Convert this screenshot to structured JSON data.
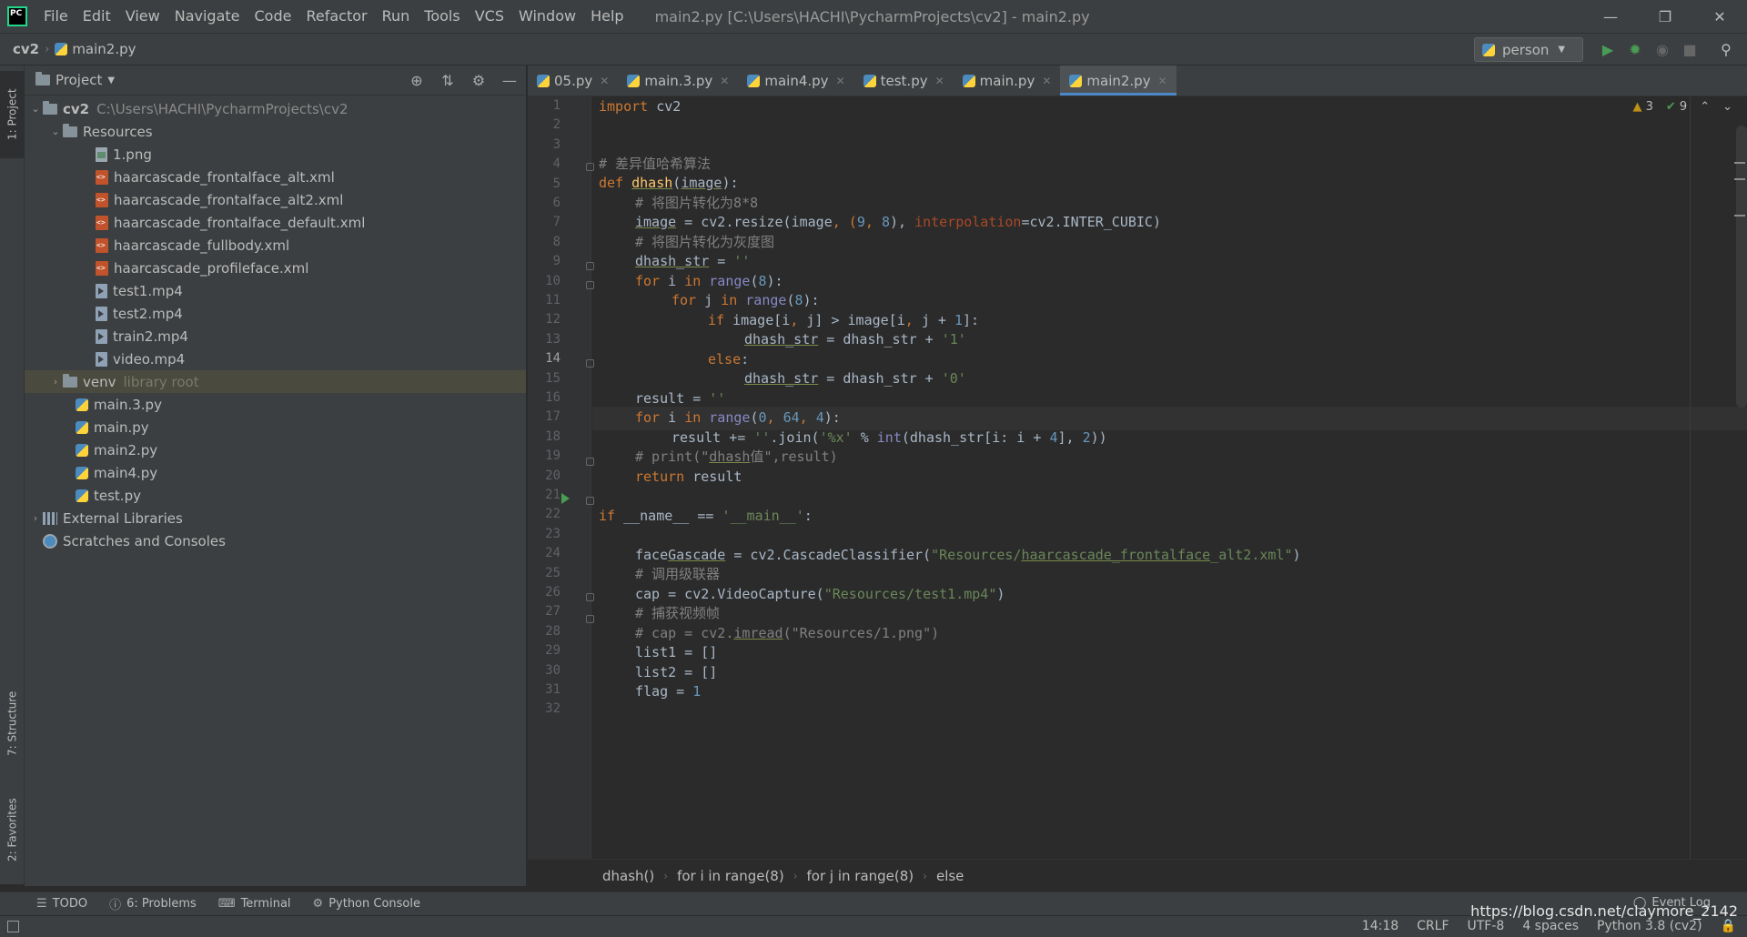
{
  "menu": [
    "File",
    "Edit",
    "View",
    "Navigate",
    "Code",
    "Refactor",
    "Run",
    "Tools",
    "VCS",
    "Window",
    "Help"
  ],
  "window_title": "main2.py [C:\\Users\\HACHI\\PycharmProjects\\cv2] - main2.py",
  "nav": {
    "project": "cv2",
    "file": "main2.py",
    "run_config": "person"
  },
  "left_strip": {
    "project_tab": "1: Project",
    "structure_tab": "7: Structure",
    "favorites_tab": "2: Favorites"
  },
  "project_panel": {
    "title": "Project",
    "root": {
      "name": "cv2",
      "path": "C:\\Users\\HACHI\\PycharmProjects\\cv2"
    },
    "resources_folder": "Resources",
    "resource_files": [
      "1.png",
      "haarcascade_frontalface_alt.xml",
      "haarcascade_frontalface_alt2.xml",
      "haarcascade_frontalface_default.xml",
      "haarcascade_fullbody.xml",
      "haarcascade_profileface.xml",
      "test1.mp4",
      "test2.mp4",
      "train2.mp4",
      "video.mp4"
    ],
    "venv": {
      "name": "venv",
      "hint": "library root"
    },
    "py_files": [
      "main.3.py",
      "main.py",
      "main2.py",
      "main4.py",
      "test.py"
    ],
    "external_libraries": "External Libraries",
    "scratches": "Scratches and Consoles"
  },
  "tabs": [
    "05.py",
    "main.3.py",
    "main4.py",
    "test.py",
    "main.py",
    "main2.py"
  ],
  "active_tab": "main2.py",
  "inspections": {
    "warnings": "3",
    "weak_warnings": "9"
  },
  "line_numbers": [
    "1",
    "2",
    "3",
    "4",
    "5",
    "6",
    "7",
    "8",
    "9",
    "10",
    "11",
    "12",
    "13",
    "14",
    "15",
    "16",
    "17",
    "18",
    "19",
    "20",
    "21",
    "22",
    "23",
    "24",
    "25",
    "26",
    "27",
    "28",
    "29",
    "30",
    "31",
    "32"
  ],
  "code": {
    "l1_kw": "import",
    "l1_rest": " cv2",
    "l4": "# 差异值哈希算法",
    "l5_kw": "def",
    "l5_fn": "dhash",
    "l5_param": "image",
    "l5_end": "):",
    "l6": "# 将图片转化为8*8",
    "l7_a": "image",
    "l7_b": " = cv2.resize(image",
    "l7_c": ", (",
    "l7_n1": "9",
    "l7_d": ", ",
    "l7_n2": "8",
    "l7_e": "), ",
    "l7_p": "interpolation",
    "l7_f": "=cv2.INTER_CUBIC)",
    "l8": "# 将图片转化为灰度图",
    "l9_a": "dhash_str",
    "l9_b": " = ",
    "l9_s": "''",
    "l10_kw": "for",
    "l10_b": " i ",
    "l10_in": "in",
    "l10_c": " ",
    "l10_bi": "range",
    "l10_d": "(",
    "l10_n": "8",
    "l10_e": "):",
    "l11_kw": "for",
    "l11_b": " j ",
    "l11_in": "in",
    "l11_c": " ",
    "l11_bi": "range",
    "l11_d": "(",
    "l11_n": "8",
    "l11_e": "):",
    "l12_kw": "if",
    "l12_b": " image[i",
    "l12_c": ", ",
    "l12_d": "j] > image[i",
    "l12_e": ", ",
    "l12_f": "j + ",
    "l12_n": "1",
    "l12_g": "]:",
    "l13_a": "dhash_str",
    "l13_b": " = dhash_str + ",
    "l13_s": "'1'",
    "l14_kw": "else",
    "l14_b": ":",
    "l15_a": "dhash_str",
    "l15_b": " = dhash_str + ",
    "l15_s": "'0'",
    "l16_a": "result = ",
    "l16_s": "''",
    "l17_kw": "for",
    "l17_b": " i ",
    "l17_in": "in",
    "l17_c": " ",
    "l17_bi": "range",
    "l17_d": "(",
    "l17_n1": "0",
    "l17_e": ", ",
    "l17_n2": "64",
    "l17_f": ", ",
    "l17_n3": "4",
    "l17_g": "):",
    "l18_a": "result += ",
    "l18_s1": "''",
    "l18_b": ".join(",
    "l18_s2": "'%x'",
    "l18_c": " % ",
    "l18_bi": "int",
    "l18_d": "(dhash_str[i: i + ",
    "l18_n1": "4",
    "l18_e": "], ",
    "l18_n2": "2",
    "l18_f": "))",
    "l19_a": "# print(\"",
    "l19_u": "dhash",
    "l19_b": "值\",result)",
    "l20_kw": "return",
    "l20_b": " result",
    "l22_kw": "if",
    "l22_b": " __name__ == ",
    "l22_s": "'__main__'",
    "l22_c": ":",
    "l24_a": "face",
    "l24_u1": "Gascade",
    "l24_b": " = cv2.CascadeClassifier(",
    "l24_s1": "\"Resources/",
    "l24_u2": "haarcascade_frontalface",
    "l24_s2": "_alt2.xml\"",
    "l24_c": ")",
    "l25": "# 调用级联器",
    "l26_a": "cap = cv2.VideoCapture(",
    "l26_s": "\"Resources/test1.mp4\"",
    "l26_b": ")",
    "l27": "# 捕获视频帧",
    "l28_a": "# cap = cv2.",
    "l28_u": "imread",
    "l28_b": "(\"Resources/1.png\")",
    "l29": "list1 = []",
    "l30": "list2 = []",
    "l31_a": "flag = ",
    "l31_n": "1"
  },
  "breadcrumb": [
    "dhash()",
    "for i in range(8)",
    "for j in range(8)",
    "else"
  ],
  "tool_windows": {
    "todo": "TODO",
    "problems": "6: Problems",
    "terminal": "Terminal",
    "python_console": "Python Console",
    "event_log": "Event Log"
  },
  "status": {
    "position": "14:18",
    "line_sep": "CRLF",
    "encoding": "UTF-8",
    "indent": "4 spaces",
    "interpreter": "Python 3.8 (cv2)"
  },
  "watermark": "https://blog.csdn.net/claymore_2142"
}
